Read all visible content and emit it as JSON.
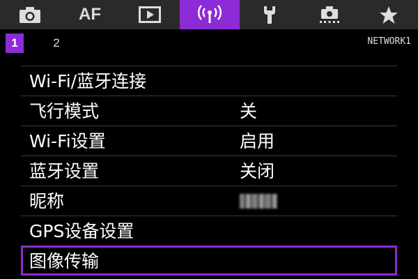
{
  "tabs": [
    {
      "name": "camera",
      "icon": "camera-icon"
    },
    {
      "name": "af",
      "label": "AF"
    },
    {
      "name": "playback",
      "icon": "play-icon"
    },
    {
      "name": "network",
      "icon": "wireless-icon",
      "active": true
    },
    {
      "name": "setup",
      "icon": "wrench-icon"
    },
    {
      "name": "custom",
      "icon": "custom-function-icon"
    },
    {
      "name": "my-menu",
      "icon": "star-icon"
    }
  ],
  "pages": {
    "active": "1",
    "second": "2",
    "title": "NETWORK1"
  },
  "menu": {
    "items": [
      {
        "label": "Wi-Fi/蓝牙连接",
        "value": ""
      },
      {
        "label": "飞行模式",
        "value": "关"
      },
      {
        "label": "Wi-Fi设置",
        "value": "启用"
      },
      {
        "label": "蓝牙设置",
        "value": "关闭"
      },
      {
        "label": "昵称",
        "value": "",
        "value_obscured": true
      },
      {
        "label": "GPS设备设置",
        "value": ""
      },
      {
        "label": "图像传输",
        "value": "",
        "selected": true
      }
    ]
  },
  "colors": {
    "accent": "#8d2bd6",
    "tabbar": "#2a2a2a",
    "background": "#000000",
    "text": "#ffffff"
  }
}
